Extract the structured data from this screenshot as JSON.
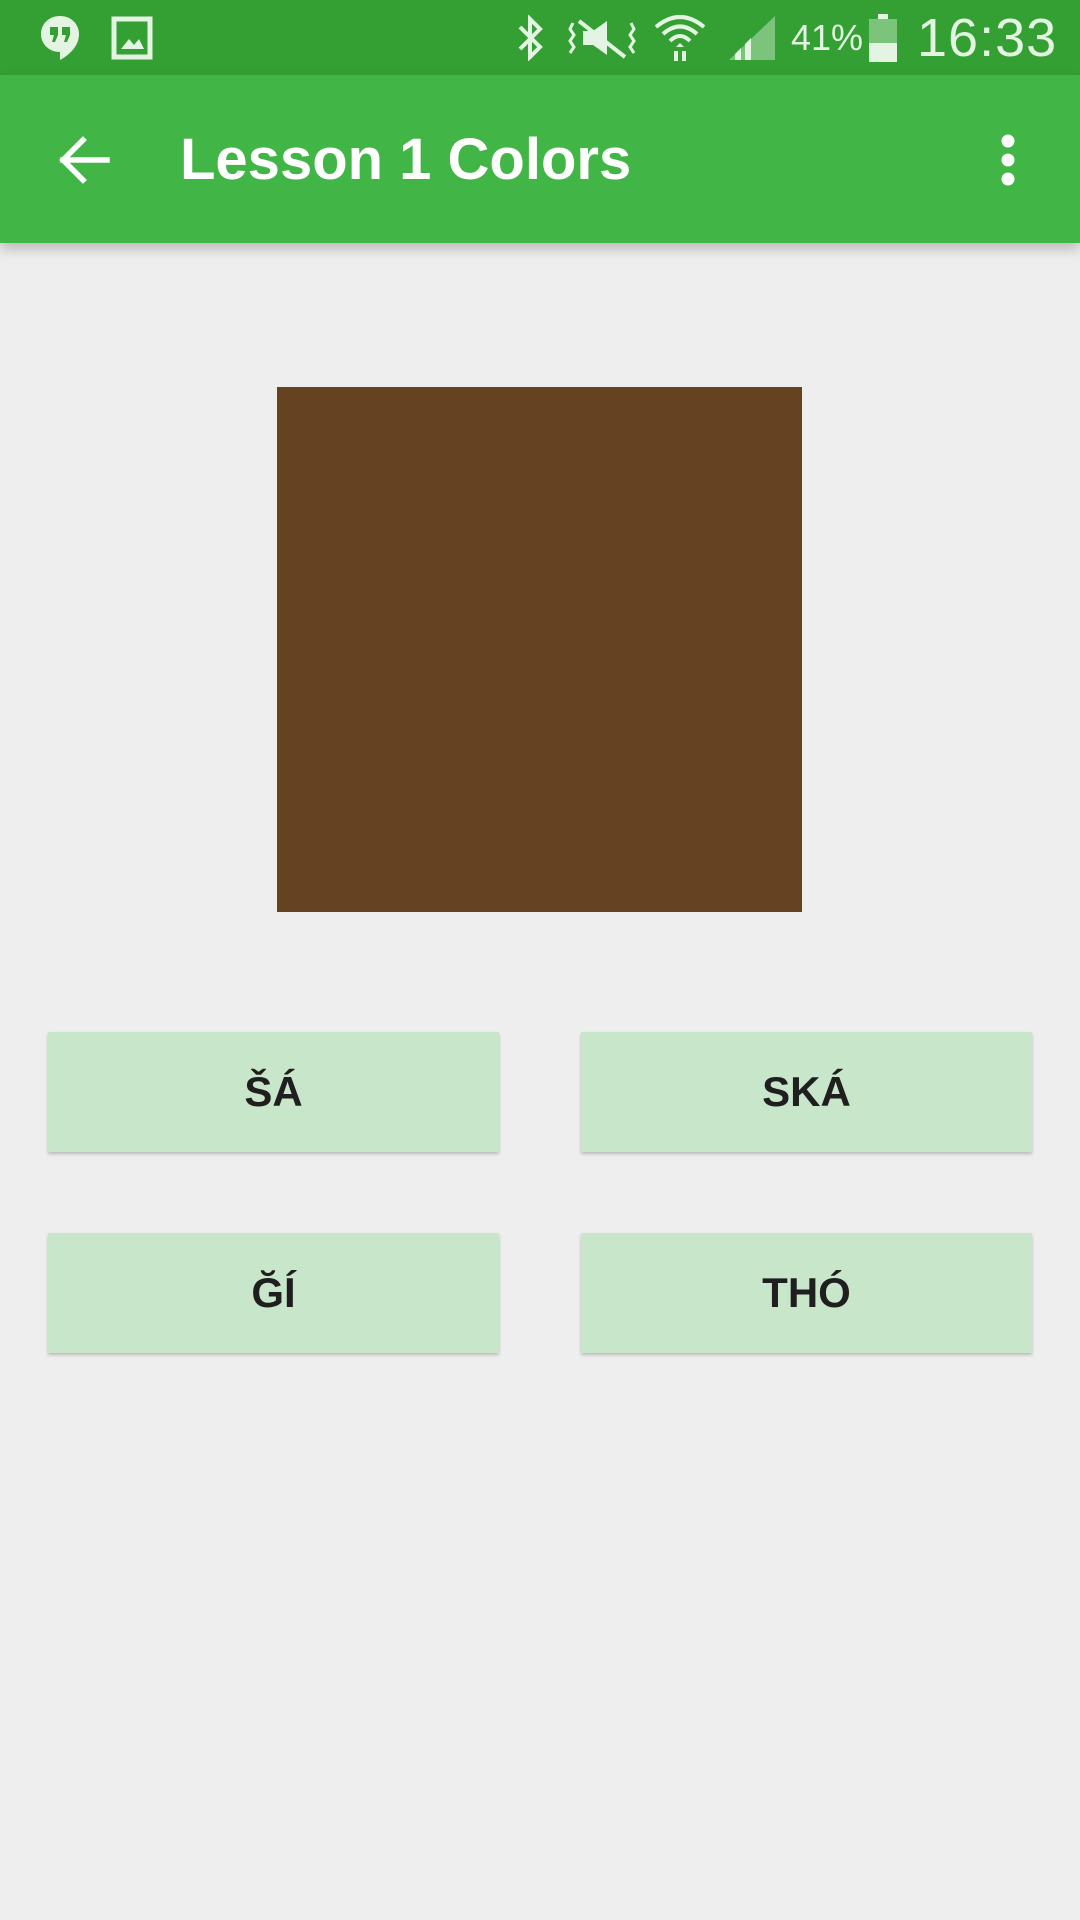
{
  "status_bar": {
    "icons": [
      "hangouts-icon",
      "gallery-icon",
      "bluetooth-icon",
      "vibrate-mute-icon",
      "wifi-icon",
      "signal-icon",
      "battery-icon"
    ],
    "battery_percent": "41%",
    "time": "16:33",
    "colors": {
      "background": "#34A034",
      "foreground": "#E3F4E3"
    }
  },
  "app_bar": {
    "title": "Lesson 1 Colors",
    "back_icon": "arrow-back-icon",
    "menu_icon": "more-vert-icon",
    "color": "#41B545"
  },
  "quiz": {
    "swatch_color": "#654321",
    "answers": [
      {
        "label": "ŠÁ"
      },
      {
        "label": "SKÁ"
      },
      {
        "label": "ĞÍ"
      },
      {
        "label": "THÓ"
      }
    ],
    "answer_color": "#C8E6C9"
  }
}
